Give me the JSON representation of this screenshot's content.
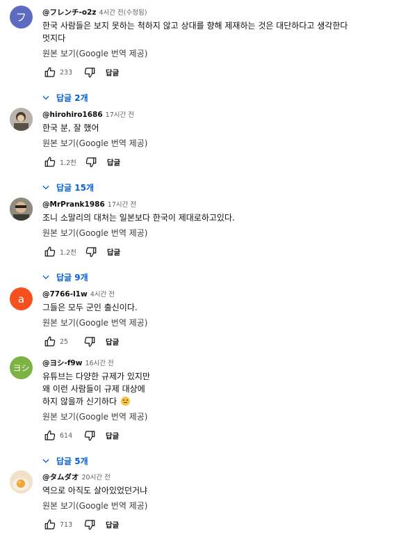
{
  "translate_label": "원본 보기(Google 번역 제공)",
  "reply_label": "답글",
  "colors": {
    "link_blue": "#065fd4",
    "text": "#0f0f0f",
    "meta": "#606060"
  },
  "comments": [
    {
      "avatar_letter": "フ",
      "avatar_color": "#5c6bc0",
      "author": "@フレンチ-o2z",
      "time": "4시간 전(수정됨)",
      "text": "한국 사람들은 보지 못하는 척하지 않고 상대를 향해 제재하는 것은 대단하다고 생각한다\n멋지다",
      "likes": "233",
      "replies": "답글 2개"
    },
    {
      "avatar_letter": "",
      "avatar_color": "#8d8a86",
      "author": "@hirohiro1686",
      "time": "17시간 전",
      "text": "한국 분, 잘 했어",
      "likes": "1.2천",
      "replies": "답글 15개"
    },
    {
      "avatar_letter": "",
      "avatar_color": "#6b6457",
      "author": "@MrPrank1986",
      "time": "17시간 전",
      "text": "조니 소말리의 대처는 일본보다 한국이 제대로하고있다.",
      "likes": "1.2천",
      "replies": "답글 9개"
    },
    {
      "avatar_letter": "a",
      "avatar_color": "#f4511e",
      "author": "@7766-l1w",
      "time": "4시간 전",
      "text": "그들은 모두 군인 출신이다.",
      "likes": "25",
      "replies": ""
    },
    {
      "avatar_letter": "ヨシ",
      "avatar_color": "#7cb342",
      "author": "@ヨシ-f9w",
      "time": "16시간 전",
      "text": "유튜브는 다양한 규제가 있지만\n왜 이런 사람들이 규제 대상에\n하지 않을까 신기하다",
      "emoji": "thinking-face",
      "likes": "614",
      "replies": "답글 5개"
    },
    {
      "avatar_letter": "",
      "avatar_color": "#f3e3c3",
      "author": "@タムダオ",
      "time": "20시간 전",
      "text": "역으로 아직도 살아있었던거냐",
      "likes": "713",
      "replies": ""
    }
  ]
}
